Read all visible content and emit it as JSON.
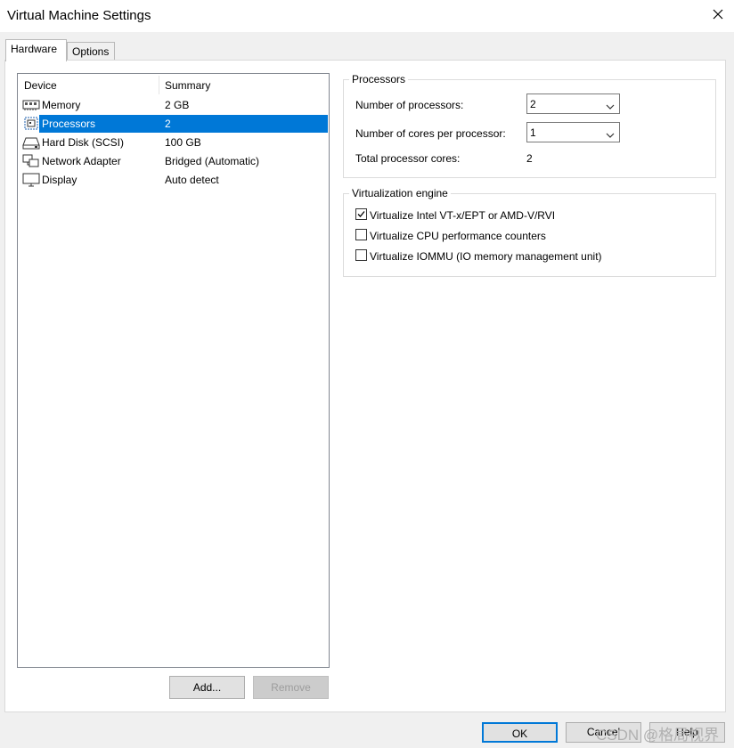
{
  "window": {
    "title": "Virtual Machine Settings"
  },
  "tabs": [
    {
      "label": "Hardware",
      "active": true
    },
    {
      "label": "Options",
      "active": false
    }
  ],
  "device_list": {
    "columns": [
      "Device",
      "Summary"
    ],
    "rows": [
      {
        "device": "Memory",
        "summary": "2 GB",
        "icon": "memory-icon"
      },
      {
        "device": "Processors",
        "summary": "2",
        "icon": "processor-icon",
        "selected": true
      },
      {
        "device": "Hard Disk (SCSI)",
        "summary": "100 GB",
        "icon": "hard-disk-icon"
      },
      {
        "device": "Network Adapter",
        "summary": "Bridged (Automatic)",
        "icon": "network-adapter-icon"
      },
      {
        "device": "Display",
        "summary": "Auto detect",
        "icon": "display-icon"
      }
    ]
  },
  "list_buttons": {
    "add": "Add...",
    "remove": "Remove"
  },
  "processors": {
    "group_title": "Processors",
    "num_processors_label": "Number of processors:",
    "num_processors_value": "2",
    "cores_label": "Number of cores per processor:",
    "cores_value": "1",
    "total_label": "Total processor cores:",
    "total_value": "2"
  },
  "virtualization": {
    "group_title": "Virtualization engine",
    "options": [
      {
        "label": "Virtualize Intel VT-x/EPT or AMD-V/RVI",
        "checked": true
      },
      {
        "label": "Virtualize CPU performance counters",
        "checked": false
      },
      {
        "label": "Virtualize IOMMU (IO memory management unit)",
        "checked": false
      }
    ]
  },
  "footer": {
    "ok": "OK",
    "cancel": "Cancel",
    "help": "Help"
  },
  "watermark": "CSDN @格局视界",
  "colors": {
    "selection": "#0078d7",
    "background": "#f0f0f0"
  }
}
